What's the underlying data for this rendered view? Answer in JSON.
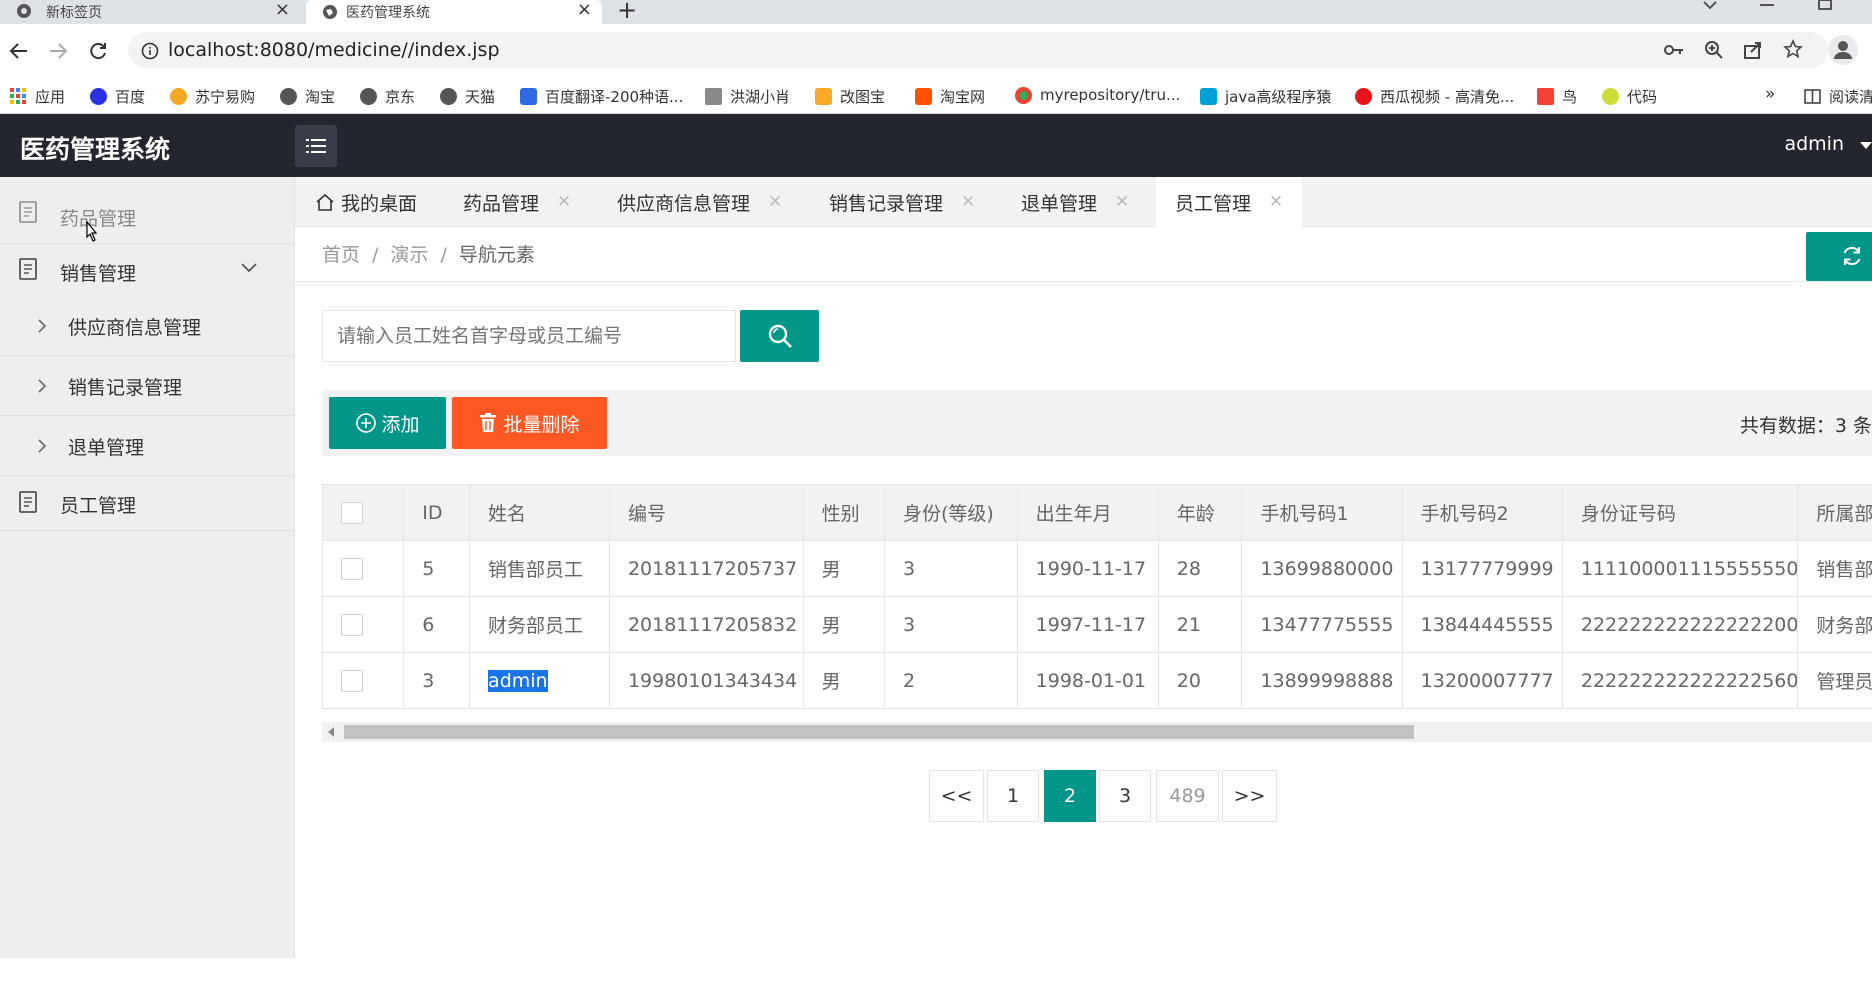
{
  "browser": {
    "tabs": [
      {
        "title": "新标签页"
      },
      {
        "title": "医药管理系统"
      }
    ],
    "new_tab": "+",
    "url": "localhost:8080/medicine//index.jsp",
    "bookmarks": [
      {
        "label": "应用",
        "icon": "apps-grid-icon"
      },
      {
        "label": "百度",
        "icon": "baidu-paw-icon"
      },
      {
        "label": "苏宁易购",
        "icon": "suning-icon"
      },
      {
        "label": "淘宝",
        "icon": "globe-icon"
      },
      {
        "label": "京东",
        "icon": "globe-icon"
      },
      {
        "label": "天猫",
        "icon": "globe-icon"
      },
      {
        "label": "百度翻译-200种语...",
        "icon": "translate-icon"
      },
      {
        "label": "洪湖小肖",
        "icon": "pen-icon"
      },
      {
        "label": "改图宝",
        "icon": "image-icon"
      },
      {
        "label": "淘宝网",
        "icon": "taobao-icon"
      },
      {
        "label": "myrepository/tru...",
        "icon": "chrome-icon"
      },
      {
        "label": "java高级程序猿",
        "icon": "bilibili-icon"
      },
      {
        "label": "西瓜视频 - 高清免...",
        "icon": "xigua-icon"
      },
      {
        "label": "鸟",
        "icon": "bird-icon"
      },
      {
        "label": "代码",
        "icon": "code-icon"
      }
    ],
    "more": "»",
    "reading_list": "阅读清"
  },
  "app": {
    "title": "医药管理系统",
    "user": "admin"
  },
  "sidebar": {
    "items": [
      {
        "label": "药品管理"
      },
      {
        "label": "销售管理"
      },
      {
        "label": "供应商信息管理"
      },
      {
        "label": "销售记录管理"
      },
      {
        "label": "退单管理"
      },
      {
        "label": "员工管理"
      }
    ]
  },
  "page_tabs": [
    {
      "label": "我的桌面"
    },
    {
      "label": "药品管理"
    },
    {
      "label": "供应商信息管理"
    },
    {
      "label": "销售记录管理"
    },
    {
      "label": "退单管理"
    },
    {
      "label": "员工管理"
    }
  ],
  "breadcrumb": {
    "home": "首页",
    "sep": "/",
    "demo": "演示",
    "current": "导航元素"
  },
  "search": {
    "placeholder": "请输入员工姓名首字母或员工编号"
  },
  "toolbar": {
    "add_label": "添加",
    "delete_label": "批量删除",
    "total": "共有数据：3 条"
  },
  "table": {
    "headers": [
      "ID",
      "姓名",
      "编号",
      "性别",
      "身份(等级)",
      "出生年月",
      "年龄",
      "手机号码1",
      "手机号码2",
      "身份证号码",
      "所属部门"
    ],
    "rows": [
      [
        "5",
        "销售部员工",
        "20181117205737",
        "男",
        "3",
        "1990-11-17",
        "28",
        "13699880000",
        "13177779999",
        "111100001115555550",
        "销售部"
      ],
      [
        "6",
        "财务部员工",
        "20181117205832",
        "男",
        "3",
        "1997-11-17",
        "21",
        "13477775555",
        "13844445555",
        "222222222222222200",
        "财务部"
      ],
      [
        "3",
        "admin",
        "19980101343434",
        "男",
        "2",
        "1998-01-01",
        "20",
        "13899998888",
        "13200007777",
        "222222222222222560",
        "管理员部"
      ]
    ]
  },
  "pagination": {
    "prev": "<<",
    "pages": [
      "1",
      "2",
      "3"
    ],
    "current": "2",
    "last": "489",
    "next": ">>"
  },
  "colors": {
    "primary": "#009688",
    "danger": "#ff5722",
    "header_bg": "#23262e",
    "sidebar_bg": "#eeeeee"
  }
}
